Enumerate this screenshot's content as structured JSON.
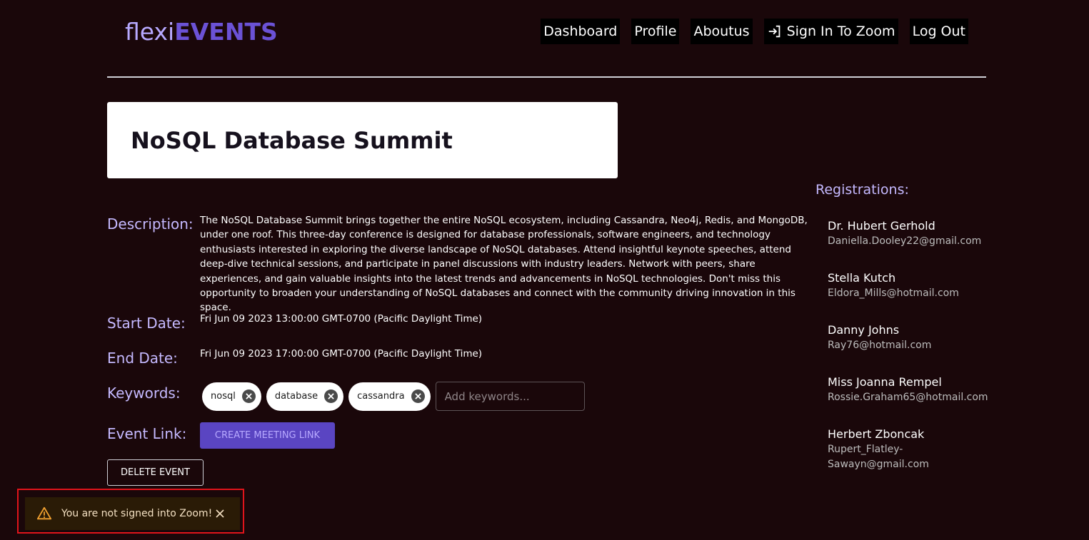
{
  "header": {
    "logo_light": "flexi",
    "logo_bold": "EVENTS",
    "nav": {
      "dashboard": "Dashboard",
      "profile": "Profile",
      "aboutus": "Aboutus",
      "sign_in_zoom": "Sign In To Zoom",
      "logout": "Log Out"
    }
  },
  "event": {
    "title": "NoSQL Database Summit",
    "description_label": "Description:",
    "description": "The NoSQL Database Summit brings together the entire NoSQL ecosystem, including Cassandra, Neo4j, Redis, and MongoDB, under one roof. This three-day conference is designed for database professionals, software engineers, and technology enthusiasts interested in exploring the diverse landscape of NoSQL databases. Attend insightful keynote speeches, attend deep-dive technical sessions, and participate in panel discussions with industry leaders. Network with peers, share experiences, and gain valuable insights into the latest trends and advancements in NoSQL technologies. Don't miss this opportunity to broaden your understanding of NoSQL databases and connect with the community driving innovation in this space.",
    "start_label": "Start Date:",
    "start_date": "Fri Jun 09 2023 13:00:00 GMT-0700 (Pacific Daylight Time)",
    "end_label": "End Date:",
    "end_date": "Fri Jun 09 2023 17:00:00 GMT-0700 (Pacific Daylight Time)",
    "keywords_label": "Keywords:",
    "keywords": [
      "nosql",
      "database",
      "cassandra"
    ],
    "keywords_placeholder": "Add keywords...",
    "event_link_label": "Event Link:",
    "create_link_button": "CREATE MEETING LINK",
    "delete_button": "DELETE EVENT"
  },
  "registrations": {
    "title": "Registrations:",
    "items": [
      {
        "name": "Dr. Hubert Gerhold",
        "email": "Daniella.Dooley22@gmail.com"
      },
      {
        "name": "Stella Kutch",
        "email": "Eldora_Mills@hotmail.com"
      },
      {
        "name": "Danny Johns",
        "email": "Ray76@hotmail.com"
      },
      {
        "name": "Miss Joanna Rempel",
        "email": "Rossie.Graham65@hotmail.com"
      },
      {
        "name": "Herbert Zboncak",
        "email": "Rupert_Flatley-Sawayn@gmail.com"
      }
    ]
  },
  "toast": {
    "message": "You are not signed into Zoom!",
    "icon": "warning-icon"
  },
  "colors": {
    "background": "#1a070a",
    "accent": "#6b52d6",
    "label": "#c5b9ff",
    "warning": "#f0a030",
    "highlight_border": "#e0141b"
  }
}
